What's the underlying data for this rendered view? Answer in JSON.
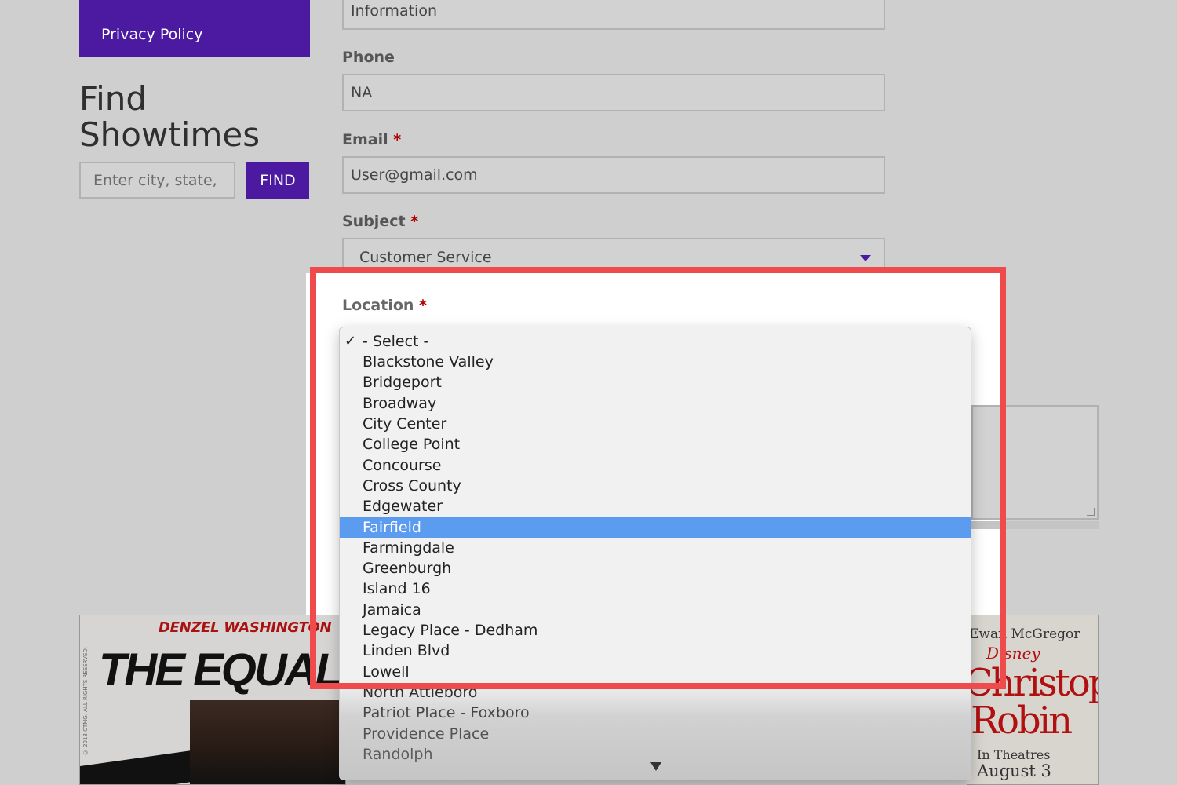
{
  "sidebar": {
    "privacy_link": "Privacy Policy",
    "find_title": "Find Showtimes",
    "find_placeholder": "Enter city, state, or zip",
    "find_button": "FIND"
  },
  "form": {
    "top_field_value": "Information",
    "phone_label": "Phone",
    "phone_value": "NA",
    "email_label": "Email",
    "email_value": "User@gmail.com",
    "subject_label": "Subject",
    "subject_value": "Customer Service",
    "location_label": "Location",
    "required_mark": "*"
  },
  "location_dropdown": {
    "selected_value": "- Select -",
    "highlighted_value": "Fairfield",
    "options": [
      "- Select -",
      "Blackstone Valley",
      "Bridgeport",
      "Broadway",
      "City Center",
      "College Point",
      "Concourse",
      "Cross County",
      "Edgewater",
      "Fairfield",
      "Farmingdale",
      "Greenburgh",
      "Island 16",
      "Jamaica",
      "Legacy Place - Dedham",
      "Linden Blvd",
      "Lowell",
      "North Attleboro",
      "Patriot Place - Foxboro",
      "Providence Place",
      "Randolph"
    ]
  },
  "posters": {
    "left": {
      "actor": "DENZEL WASHINGTON",
      "title": "THE EQUALIZER",
      "copyright": "© 2018 CTMG. ALL RIGHTS RESERVED."
    },
    "right": {
      "actor": "Ewan McGregor",
      "brand": "Disney",
      "title_line1": "Christopher",
      "title_line2": "Robin",
      "release_line1": "In Theatres",
      "release_line2": "August 3"
    }
  },
  "colors": {
    "brand_purple": "#4b1aa0",
    "highlight_red": "#ef4a4c",
    "option_highlight": "#5b9cf0"
  }
}
